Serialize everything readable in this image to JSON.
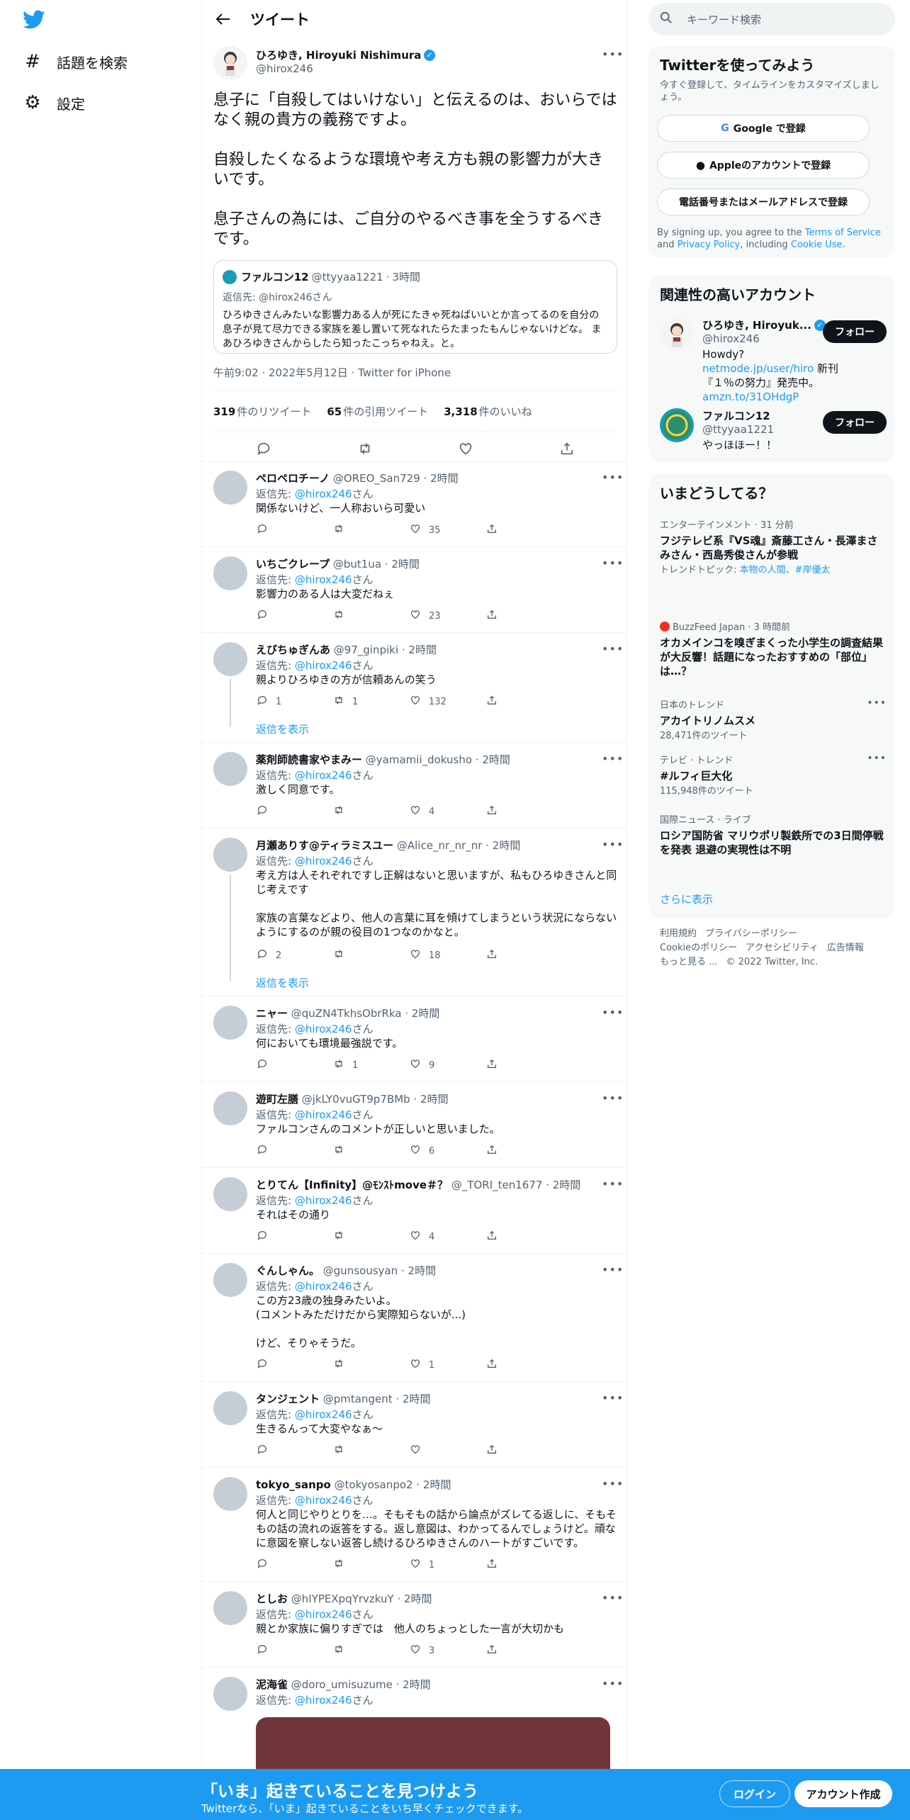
{
  "nav": {
    "logo": "twitter-bird",
    "items": [
      {
        "icon": "#",
        "label": "話題を検索"
      },
      {
        "icon": "⚙",
        "label": "設定"
      }
    ]
  },
  "header": {
    "title": "ツイート"
  },
  "main_tweet": {
    "name": "ひろゆき, Hiroyuki Nishimura",
    "handle": "@hirox246",
    "paragraphs": [
      "息子に「自殺してはいけない」と伝えるのは、おいらではなく親の貴方の義務ですよ。",
      "自殺したくなるような環境や考え方も親の影響力が大きいです。",
      "息子さんの為には、ご自分のやるべき事を全うするべきです。"
    ],
    "quote": {
      "name": "ファルコン12",
      "handle": "@ttyyaa1221",
      "time": "3時間",
      "reply_to": "返信先: @hirox246さん",
      "text": "ひろゆきさんみたいな影響力ある人が死にたきゃ死ねばいいとか言ってるのを自分の息子が見て尽力できる家族を差し置いて死なれたらたまったもんじゃないけどな。 まあひろゆきさんからしたら知ったこっちゃねえ。と。"
    },
    "timestamp": "午前9:02 · 2022年5月12日 · Twitter for iPhone",
    "stats": [
      {
        "count": "319",
        "label": "件のリツイート"
      },
      {
        "count": "65",
        "label": "件の引用ツイート"
      },
      {
        "count": "3,318",
        "label": "件のいいね"
      }
    ]
  },
  "reply_to_prefix": "返信先: ",
  "reply_to_suffix": "さん",
  "reply_to_link": "@hirox246",
  "show_replies_label": "返信を表示",
  "replies": [
    {
      "name": "ペロペロチーノ",
      "handle": "@OREO_San729",
      "time": "2時間",
      "text": [
        "関係ないけど、一人称おいら可愛い"
      ],
      "reply": "",
      "retweet": "",
      "like": "35"
    },
    {
      "name": "いちごクレープ",
      "handle": "@but1ua",
      "time": "2時間",
      "text": [
        "影響力のある人は大変だねぇ"
      ],
      "reply": "",
      "retweet": "",
      "like": "23"
    },
    {
      "name": "えびちゅぎんあ",
      "handle": "@97_ginpiki",
      "time": "2時間",
      "text": [
        "親よりひろゆきの方が信頼あんの笑う"
      ],
      "reply": "1",
      "retweet": "1",
      "like": "132"
    },
    {
      "name": "薬剤師読書家やまみー",
      "handle": "@yamamii_dokusho",
      "time": "2時間",
      "text": [
        "激しく同意です。"
      ],
      "reply": "",
      "retweet": "",
      "like": "4"
    },
    {
      "name": "月瀬ありす@ティラミスユー",
      "handle": "@Alice_nr_nr_nr",
      "time": "2時間",
      "text": [
        "考え方は人それぞれですし正解はないと思いますが、私もひろゆきさんと同じ考えです",
        "",
        "家族の言葉などより、他人の言葉に耳を傾けてしまうという状況にならないようにするのが親の役目の1つなのかなと。"
      ],
      "reply": "2",
      "retweet": "",
      "like": "18"
    },
    {
      "name": "ニャー",
      "handle": "@quZN4TkhsObrRka",
      "time": "2時間",
      "text": [
        "何においても環境最強説です。"
      ],
      "reply": "",
      "retweet": "1",
      "like": "9"
    },
    {
      "name": "遊町左膳",
      "handle": "@jkLY0vuGT9p7BMb",
      "time": "2時間",
      "text": [
        "ファルコンさんのコメントが正しいと思いました。"
      ],
      "reply": "",
      "retweet": "",
      "like": "6"
    },
    {
      "name": "とりてん【Infinity】@ﾓﾝｽﾄmove＃？",
      "handle": "@_TORI_ten1677",
      "time": "2時間",
      "text": [
        "それはその通り"
      ],
      "reply": "",
      "retweet": "",
      "like": "4"
    },
    {
      "name": "ぐんしゃん。",
      "handle": "@gunsousyan",
      "time": "2時間",
      "text": [
        "この方23歳の独身みたいよ。",
        "(コメントみただけだから実際知らないが...)",
        "",
        "けど、そりゃそうだ。"
      ],
      "reply": "",
      "retweet": "",
      "like": "1"
    },
    {
      "name": "タンジェント",
      "handle": "@pmtangent",
      "time": "2時間",
      "text": [
        "生きるんって大変やなぁ〜"
      ],
      "reply": "",
      "retweet": "",
      "like": ""
    },
    {
      "name": "tokyo_sanpo",
      "handle": "@tokyosanpo2",
      "time": "2時間",
      "text": [
        "何人と同じやりとりを…。そもそもの話から論点がズレてる返しに、そもそもの話の流れの返答をする。返し意図は、わかってるんでしょうけど。頑なに意図を察しない返答し続けるひろゆきさんのハートがすごいです。"
      ],
      "reply": "",
      "retweet": "",
      "like": "1"
    },
    {
      "name": "としお",
      "handle": "@hIYPEXpqYrvzkuY",
      "time": "2時間",
      "text": [
        "親とか家族に偏りすぎでは　他人のちょっとした一言が大切かも"
      ],
      "reply": "",
      "retweet": "",
      "like": "3"
    },
    {
      "name": "泥海雀",
      "handle": "@doro_umisuzume",
      "time": "2時間",
      "text": [],
      "reply": "",
      "retweet": "",
      "like": ""
    }
  ],
  "right": {
    "search_placeholder": "キーワード検索",
    "signup": {
      "title": "Twitterを使ってみよう",
      "subtitle": "今すぐ登録して、タイムラインをカスタマイズしましょう。",
      "google": "Google で登録",
      "apple": "Appleのアカウントで登録",
      "phone": "電話番号またはメールアドレスで登録",
      "legal_1": "By signing up, you agree to the ",
      "terms": "Terms of Service",
      "legal_2": " and ",
      "privacy": "Privacy Policy",
      "legal_3": ", including ",
      "cookie": "Cookie Use",
      "legal_4": "."
    },
    "relevant": {
      "title": "関連性の高いアカウント",
      "follow_label": "フォロー",
      "accounts": [
        {
          "name": "ひろゆき, Hiroyuk...",
          "handle": "@hirox246",
          "bio_1": "Howdy? ",
          "bio_link1": "netmode.jp/user/hiro",
          "bio_2": " 新刊『１％の努力』発売中。",
          "bio_link2": "amzn.to/31OHdgP"
        },
        {
          "name": "ファルコン12",
          "handle": "@ttyyaa1221",
          "bio_1": "やっほほー！！",
          "bio_link1": "",
          "bio_2": "",
          "bio_link2": ""
        }
      ]
    },
    "trends": {
      "title": "いまどうしてる？",
      "items": [
        {
          "meta": "エンターテインメント · 31 分前",
          "name": "フジテレビ系『VS魂』斎藤工さん・長澤まさみさん・西島秀俊さんが参戦",
          "sub_label": "トレンドトピック: ",
          "sub_links": "本物の人間、#岸優太"
        },
        {
          "meta": "BuzzFeed Japan · 3 時間前",
          "name": "オカメインコを嗅ぎまくった小学生の調査結果が大反響！話題になったおすすめの「部位」は…？",
          "sub_label": "",
          "sub_links": ""
        },
        {
          "meta": "日本のトレンド",
          "name": "アカイトリノムスメ",
          "sub_label": "28,471件のツイート",
          "sub_links": ""
        },
        {
          "meta": "テレビ · トレンド",
          "name": "#ルフィ巨大化",
          "sub_label": "115,948件のツイート",
          "sub_links": ""
        },
        {
          "meta": "国際ニュース · ライブ",
          "name": "ロシア国防省 マリウポリ製鉄所での3日間停戦を発表 退避の実現性は不明",
          "sub_label": "",
          "sub_links": ""
        }
      ],
      "show_more": "さらに表示"
    },
    "footer": {
      "line1": [
        "利用規約",
        "プライバシーポリシー"
      ],
      "line2": [
        "Cookieのポリシー",
        "アクセシビリティ",
        "広告情報"
      ],
      "line3": [
        "もっと見る ...",
        "© 2022 Twitter, Inc."
      ]
    }
  },
  "bottom_bar": {
    "title": "「いま」起きていることを見つけよう",
    "subtitle": "Twitterなら、「いま」起きていることをいち早くチェックできます。",
    "login": "ログイン",
    "signup": "アカウント作成"
  },
  "colors": {
    "accent": "#1d9bf0",
    "banner": "#1d9bf0",
    "text": "#0f1419",
    "muted": "#536471"
  }
}
